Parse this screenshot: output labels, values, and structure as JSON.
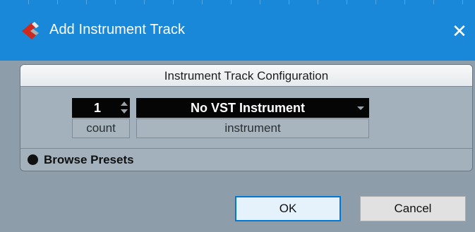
{
  "window": {
    "title": "Add Instrument Track",
    "close_glyph": "✕",
    "icon": "cubase-logo-icon",
    "accent_color": "#1a88d8"
  },
  "panel": {
    "header": "Instrument Track Configuration",
    "count": {
      "value": "1",
      "label": "count"
    },
    "instrument": {
      "value": "No VST Instrument",
      "label": "instrument"
    },
    "browse_presets": "Browse Presets"
  },
  "buttons": {
    "ok": "OK",
    "cancel": "Cancel"
  }
}
